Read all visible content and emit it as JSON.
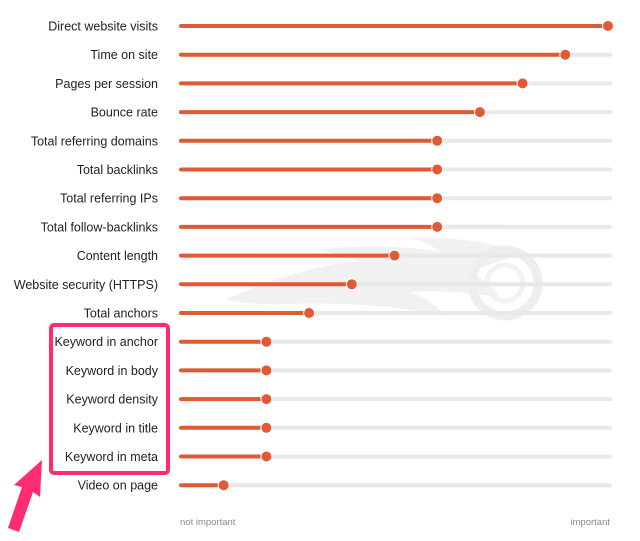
{
  "chart_data": {
    "type": "bar",
    "orientation": "horizontal",
    "style": "lollipop",
    "title": "",
    "xlabel": "",
    "ylabel": "",
    "xlim": [
      0,
      1
    ],
    "x_axis_labels": {
      "min": "not important",
      "max": "important"
    },
    "categories": [
      "Direct website visits",
      "Time on site",
      "Pages per session",
      "Bounce rate",
      "Total referring domains",
      "Total backlinks",
      "Total referring IPs",
      "Total follow-backlinks",
      "Content length",
      "Website security (HTTPS)",
      "Total anchors",
      "Keyword in anchor",
      "Keyword in body",
      "Keyword density",
      "Keyword in title",
      "Keyword in meta",
      "Video on page"
    ],
    "values": [
      1.0,
      0.9,
      0.8,
      0.7,
      0.6,
      0.6,
      0.6,
      0.6,
      0.5,
      0.4,
      0.3,
      0.2,
      0.2,
      0.2,
      0.2,
      0.2,
      0.1
    ],
    "highlighted_categories": [
      "Keyword in anchor",
      "Keyword in body",
      "Keyword density",
      "Keyword in title",
      "Keyword in meta"
    ],
    "grid": false,
    "legend": "none"
  },
  "colors": {
    "bar": "#e05a35",
    "track": "#e8e8e8",
    "highlight": "#ff2d6f",
    "label": "#222222",
    "axis_label": "#8a8a8a",
    "watermark": "#f0f0f0"
  },
  "annotations": {
    "highlight_box": "highlight-box",
    "arrow": "arrow-icon",
    "watermark": "semrush-flame-logo-icon"
  }
}
